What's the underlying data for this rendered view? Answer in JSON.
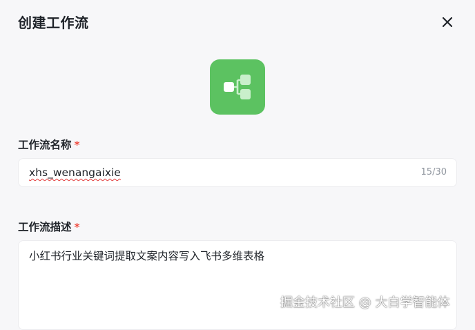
{
  "dialog": {
    "title": "创建工作流",
    "close_icon": "close-icon"
  },
  "workflow_icon": {
    "icon": "workflow-icon",
    "bg_color": "#5cc261"
  },
  "form": {
    "name_label": "工作流名称",
    "name_required": "*",
    "name_value": "xhs_wenangaixie",
    "name_count": "15/30",
    "desc_label": "工作流描述",
    "desc_required": "*",
    "desc_value": "小红书行业关键词提取文案内容写入飞书多维表格"
  },
  "watermark": "掘金技术社区 @ 大白学智能体",
  "colors": {
    "required": "#f04a3e",
    "spellcheck": "#e23a3a"
  }
}
